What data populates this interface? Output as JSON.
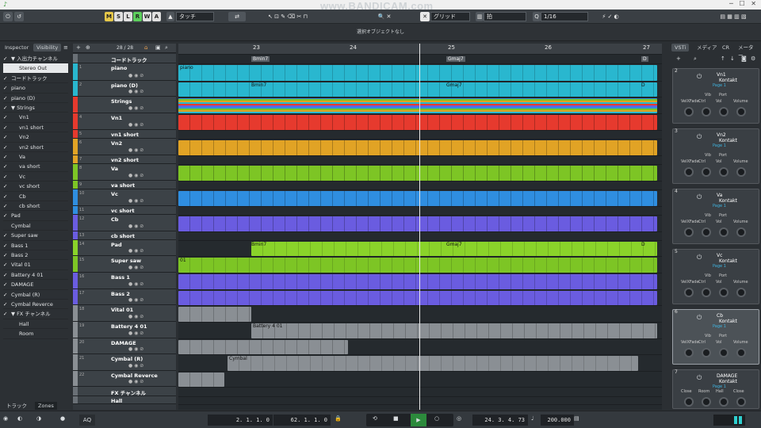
{
  "watermark": "www.BANDICAM.com",
  "toolbar": {
    "mode_buttons": [
      {
        "label": "M",
        "color": "#e6c84a"
      },
      {
        "label": "S",
        "color": "#e0e0e0"
      },
      {
        "label": "L",
        "color": "#e0e0e0"
      },
      {
        "label": "R",
        "color": "#5ccf5c"
      },
      {
        "label": "W",
        "color": "#e0e0e0"
      },
      {
        "label": "A",
        "color": "#e0e0e0"
      }
    ],
    "automation_mode": "タッチ",
    "snap_type": "グリッド",
    "grid_type": "拍",
    "quantize": "1/16"
  },
  "infoline": "選択オブジェクトなし",
  "left": {
    "tabs": [
      "Inspector",
      "Visibility"
    ],
    "active_tab": "Visibility",
    "bottom_tabs": [
      "トラック",
      "Zones"
    ],
    "rows": [
      {
        "label": "▼ 入出力チャンネル",
        "checked": true,
        "indent": 0
      },
      {
        "label": "Stereo Out",
        "checked": true,
        "indent": 1
      },
      {
        "label": "コードトラック",
        "checked": true,
        "indent": 0
      },
      {
        "label": "piano",
        "checked": true,
        "indent": 0
      },
      {
        "label": "piano (D)",
        "checked": true,
        "indent": 0
      },
      {
        "label": "▼ Strings",
        "checked": true,
        "indent": 0
      },
      {
        "label": "Vn1",
        "checked": true,
        "indent": 1
      },
      {
        "label": "vn1 short",
        "checked": true,
        "indent": 1
      },
      {
        "label": "Vn2",
        "checked": true,
        "indent": 1
      },
      {
        "label": "vn2 short",
        "checked": true,
        "indent": 1
      },
      {
        "label": "Va",
        "checked": true,
        "indent": 1
      },
      {
        "label": "va short",
        "checked": true,
        "indent": 1
      },
      {
        "label": "Vc",
        "checked": true,
        "indent": 1
      },
      {
        "label": "vc short",
        "checked": true,
        "indent": 1
      },
      {
        "label": "Cb",
        "checked": true,
        "indent": 1
      },
      {
        "label": "cb short",
        "checked": true,
        "indent": 1
      },
      {
        "label": "Pad",
        "checked": true,
        "indent": 0
      },
      {
        "label": "Cymbal",
        "checked": false,
        "indent": 0
      },
      {
        "label": "Super saw",
        "checked": true,
        "indent": 0
      },
      {
        "label": "Bass 1",
        "checked": true,
        "indent": 0
      },
      {
        "label": "Bass 2",
        "checked": true,
        "indent": 0
      },
      {
        "label": "Vital 01",
        "checked": true,
        "indent": 0
      },
      {
        "label": "Battery 4 01",
        "checked": true,
        "indent": 0
      },
      {
        "label": "DAMAGE",
        "checked": true,
        "indent": 0
      },
      {
        "label": "Cymbal (R)",
        "checked": true,
        "indent": 0
      },
      {
        "label": "Cymbal Reverce",
        "checked": true,
        "indent": 0
      },
      {
        "label": "▼ FX チャンネル",
        "checked": true,
        "indent": 0
      },
      {
        "label": "Hall",
        "checked": false,
        "indent": 1
      },
      {
        "label": "Room",
        "checked": false,
        "indent": 1
      }
    ]
  },
  "tracklist": {
    "count": "28 / 28",
    "tracks": [
      {
        "name": "コードトラック",
        "num": "",
        "color": "#6a7076"
      },
      {
        "name": "piano",
        "num": "1",
        "color": "#29b7cf"
      },
      {
        "name": "piano (D)",
        "num": "2",
        "color": "#29b7cf"
      },
      {
        "name": "Strings",
        "num": "",
        "color": "#e63a2e"
      },
      {
        "name": "Vn1",
        "num": "4",
        "color": "#e63a2e"
      },
      {
        "name": "vn1 short",
        "num": "5",
        "color": "#e63a2e"
      },
      {
        "name": "Vn2",
        "num": "6",
        "color": "#e1a325"
      },
      {
        "name": "vn2 short",
        "num": "7",
        "color": "#e1a325"
      },
      {
        "name": "Va",
        "num": "8",
        "color": "#7dc525"
      },
      {
        "name": "va short",
        "num": "9",
        "color": "#7dc525"
      },
      {
        "name": "Vc",
        "num": "10",
        "color": "#2f8ee0"
      },
      {
        "name": "vc short",
        "num": "11",
        "color": "#2f8ee0"
      },
      {
        "name": "Cb",
        "num": "12",
        "color": "#6a5ce0"
      },
      {
        "name": "cb short",
        "num": "13",
        "color": "#6a5ce0"
      },
      {
        "name": "Pad",
        "num": "14",
        "color": "#8ad32a"
      },
      {
        "name": "Super saw",
        "num": "15",
        "color": "#7dc525"
      },
      {
        "name": "Bass 1",
        "num": "16",
        "color": "#6a5ce0"
      },
      {
        "name": "Bass 2",
        "num": "17",
        "color": "#6a5ce0"
      },
      {
        "name": "Vital 01",
        "num": "18",
        "color": "#8a8f94"
      },
      {
        "name": "Battery 4 01",
        "num": "19",
        "color": "#8a8f94"
      },
      {
        "name": "DAMAGE",
        "num": "20",
        "color": "#8a8f94"
      },
      {
        "name": "Cymbal (R)",
        "num": "21",
        "color": "#8a8f94"
      },
      {
        "name": "Cymbal Reverce",
        "num": "22",
        "color": "#8a8f94"
      },
      {
        "name": "FX チャンネル",
        "num": "",
        "color": "#6a7076"
      },
      {
        "name": "Hall",
        "num": "",
        "color": "#6a7076"
      }
    ]
  },
  "ruler": {
    "bars": [
      "23",
      "24",
      "25",
      "26",
      "27"
    ]
  },
  "chords": {
    "bmin": "Bmin7",
    "gmaj": "Gmaj7",
    "d": "D"
  },
  "events": {
    "piano": "piano",
    "pianoD_b": "Bmin7",
    "pianoD_g": "Gmaj7",
    "pianoD_d": "D",
    "pad_b": "Bmin7",
    "pad_g": "Gmaj7",
    "pad_d": "D",
    "supersaw": "01",
    "battery": "Battery 4 01",
    "cymbal": "Cymbal"
  },
  "right": {
    "tabs": [
      "VSTi",
      "メディア",
      "CR",
      "メーター"
    ],
    "active_tab": "VSTi",
    "slots": [
      {
        "num": "2",
        "name": "Vn1",
        "plugin": "Kontakt",
        "page": "Page 1",
        "params": [
          "VelXFade",
          "Ctrl",
          "Vol",
          "Volume"
        ],
        "top_params": [
          "Vib",
          "Port"
        ]
      },
      {
        "num": "3",
        "name": "Vn2",
        "plugin": "Kontakt",
        "page": "Page 1",
        "params": [
          "VelXFade",
          "Ctrl",
          "Vol",
          "Volume"
        ],
        "top_params": [
          "Vib",
          "Port"
        ]
      },
      {
        "num": "4",
        "name": "Va",
        "plugin": "Kontakt",
        "page": "Page 1",
        "params": [
          "VelXFade",
          "Ctrl",
          "Vol",
          "Volume"
        ],
        "top_params": [
          "Vib",
          "Port"
        ]
      },
      {
        "num": "5",
        "name": "Vc",
        "plugin": "Kontakt",
        "page": "Page 1",
        "params": [
          "VelXFade",
          "Ctrl",
          "Vol",
          "Volume"
        ],
        "top_params": [
          "Vib",
          "Port"
        ]
      },
      {
        "num": "6",
        "name": "Cb",
        "plugin": "Kontakt",
        "page": "Page 1",
        "params": [
          "VelXFade",
          "Ctrl",
          "Vol",
          "Volume"
        ],
        "top_params": [
          "Vib",
          "Port"
        ]
      },
      {
        "num": "7",
        "name": "DAMAGE",
        "plugin": "Kontakt",
        "page": "Page 1",
        "params": [
          "Close",
          "Room",
          "Hall",
          "Close"
        ],
        "top_params": []
      }
    ]
  },
  "transport": {
    "left_locator": "2. 1. 1. 0",
    "right_locator": "62. 1. 1. 0",
    "position": "24. 3. 4. 73",
    "tempo": "200.000",
    "aq": "AQ"
  }
}
